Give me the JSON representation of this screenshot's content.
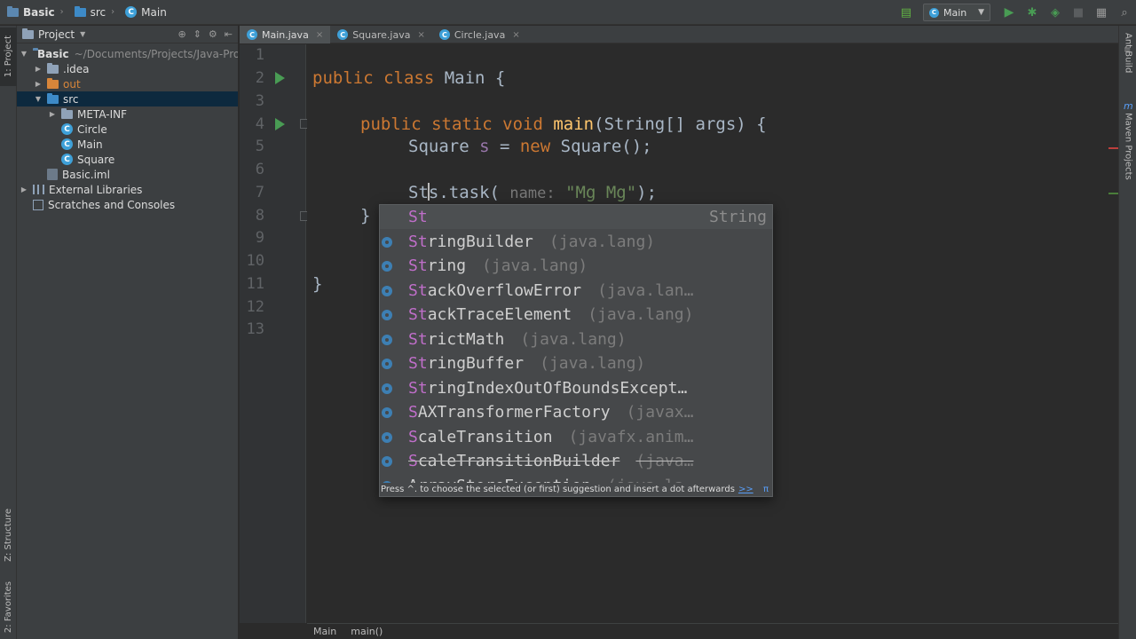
{
  "navbar": {
    "crumbs": [
      "Basic",
      "src",
      "Main"
    ],
    "run_config": "Main"
  },
  "left_stripe": {
    "tabs": [
      "1: Project",
      "Z: Structure",
      "2: Favorites"
    ]
  },
  "project_panel": {
    "title": "Project",
    "tree": [
      {
        "label": "Basic",
        "detail": "~/Documents/Projects/Java-Proj",
        "level": 0,
        "expanded": true,
        "icon": "module-folder-icon"
      },
      {
        "label": ".idea",
        "level": 1,
        "expanded": false,
        "icon": "folder-icon"
      },
      {
        "label": "out",
        "level": 1,
        "expanded": false,
        "icon": "folder-icon"
      },
      {
        "label": "src",
        "level": 1,
        "expanded": true,
        "icon": "source-folder-icon",
        "selected": true
      },
      {
        "label": "META-INF",
        "level": 2,
        "expanded": false,
        "icon": "folder-icon"
      },
      {
        "label": "Circle",
        "level": 2,
        "icon": "class-icon"
      },
      {
        "label": "Main",
        "level": 2,
        "icon": "class-icon"
      },
      {
        "label": "Square",
        "level": 2,
        "icon": "class-icon"
      },
      {
        "label": "Basic.iml",
        "level": 1,
        "icon": "iml-file-icon"
      },
      {
        "label": "External Libraries",
        "level": 0,
        "expanded": false,
        "icon": "library-icon"
      },
      {
        "label": "Scratches and Consoles",
        "level": 0,
        "icon": "scratches-icon"
      }
    ]
  },
  "tabs": [
    {
      "label": "Main.java",
      "active": true
    },
    {
      "label": "Square.java",
      "active": false
    },
    {
      "label": "Circle.java",
      "active": false
    }
  ],
  "editor": {
    "line_numbers": [
      "1",
      "2",
      "3",
      "4",
      "5",
      "6",
      "7",
      "8",
      "9",
      "10",
      "11",
      "12",
      "13"
    ],
    "code": {
      "l2_kw": "public class",
      "l2_rest": " Main {",
      "l4_kw": "public static void",
      "l4_fn": "main",
      "l4_rest": "(String[] args) {",
      "l5_a": "Square ",
      "l5_var": "s",
      "l5_b": " = ",
      "l5_kw": "new",
      "l5_c": " Square();",
      "l7_typed": "St",
      "l7_after": "s.task(",
      "l7_hint": "name:",
      "l7_str": "\"Mg Mg\"",
      "l7_end": ");",
      "l8": "}",
      "l11": "}"
    }
  },
  "completion": {
    "first": {
      "match": "St",
      "type": "String"
    },
    "items": [
      {
        "match": "St",
        "rest": "ringBuilder",
        "pkg": "(java.lang)"
      },
      {
        "match": "St",
        "rest": "ring",
        "pkg": "(java.lang)"
      },
      {
        "match": "St",
        "rest": "ackOverflowError",
        "pkg": "(java.lan…"
      },
      {
        "match": "St",
        "rest": "ackTraceElement",
        "pkg": "(java.lang)"
      },
      {
        "match": "St",
        "rest": "rictMath",
        "pkg": "(java.lang)"
      },
      {
        "match": "St",
        "rest": "ringBuffer",
        "pkg": "(java.lang)"
      },
      {
        "match": "St",
        "rest": "ringIndexOutOfBoundsExcept…",
        "pkg": ""
      },
      {
        "match": "S",
        "rest": "AXTransformerFactory",
        "pkg": "(javax…"
      },
      {
        "match": "S",
        "rest": "caleTransition",
        "pkg": "(javafx.anim…"
      },
      {
        "match": "S",
        "rest": "caleTransitionBuilder",
        "pkg": "(java…",
        "deprecated": true
      },
      {
        "match": "",
        "rest": "ArrayStoreException",
        "pkg": "(java.la"
      }
    ],
    "footer_text": "Press ^. to choose the selected (or first) suggestion and insert a dot afterwards",
    "footer_link": ">>",
    "footer_pi": "π"
  },
  "right_stripe": {
    "tabs": [
      "Ant Build",
      "Maven Projects"
    ]
  },
  "footer": {
    "crumbs": [
      "Main",
      "main()"
    ]
  }
}
